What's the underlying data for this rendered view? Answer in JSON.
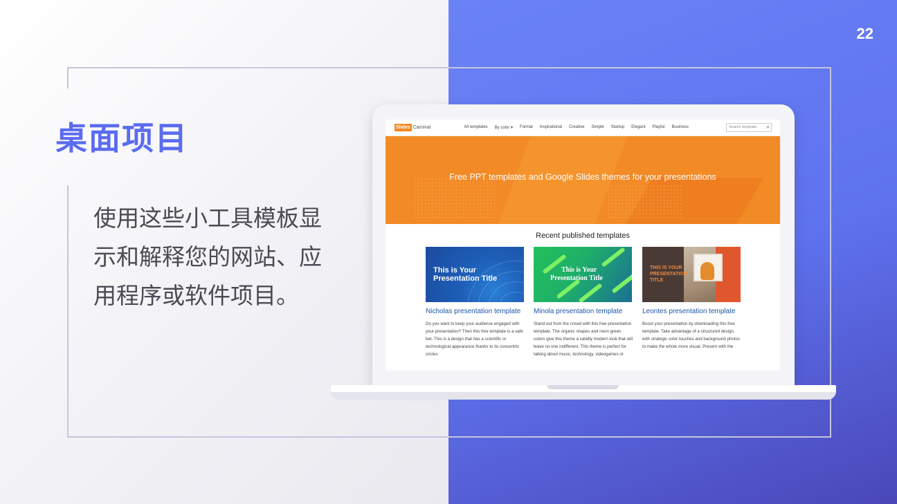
{
  "slide": {
    "number": "22",
    "title": "桌面项目",
    "body": "使用这些小工具模板显示和解释您的网站、应用程序或软件项目。"
  },
  "screen": {
    "logo": {
      "brand": "Slides",
      "name": "Carnival"
    },
    "nav_items": [
      "All templates",
      "By color ▾",
      "Formal",
      "Inspirational",
      "Creative",
      "Simple",
      "Startup",
      "Elegant",
      "Playful",
      "Business"
    ],
    "search_placeholder": "Search template",
    "hero_title": "Free PPT templates and Google Slides themes for your presentations",
    "recent_title": "Recent published templates",
    "cards": [
      {
        "thumb_text_1": "This is Your",
        "thumb_text_2": "Presentation Title",
        "name": "Nicholas presentation template",
        "desc": "Do you want to keep your audience engaged with your presentation? Then this free template is a safe bet. This is a design that has a scientific or technological appearance thanks to its concentric circles"
      },
      {
        "thumb_text_1": "This is Your",
        "thumb_text_2": "Presentation Title",
        "name": "Minola presentation template",
        "desc": "Stand out from the crowd with this free presentation template. The organic shapes and neon green colors give this theme a rabidly modern look that will leave no one indifferent. This theme is perfect for talking about music, technology, videogames or"
      },
      {
        "thumb_text_1": "THIS IS YOUR",
        "thumb_text_2": "PRESENTATION",
        "thumb_text_3": "TITLE",
        "name": "Leontes presentation template",
        "desc": "Boost your presentation by downloading this free template. Take advantage of a structured design, with strategic color touches and background photos to make the whole more visual. Present with the"
      }
    ]
  },
  "colors": {
    "accent": "#5b6cf0",
    "right_panel": "#6073f0",
    "hero_orange": "#f28a26",
    "link_blue": "#1c55a8"
  }
}
